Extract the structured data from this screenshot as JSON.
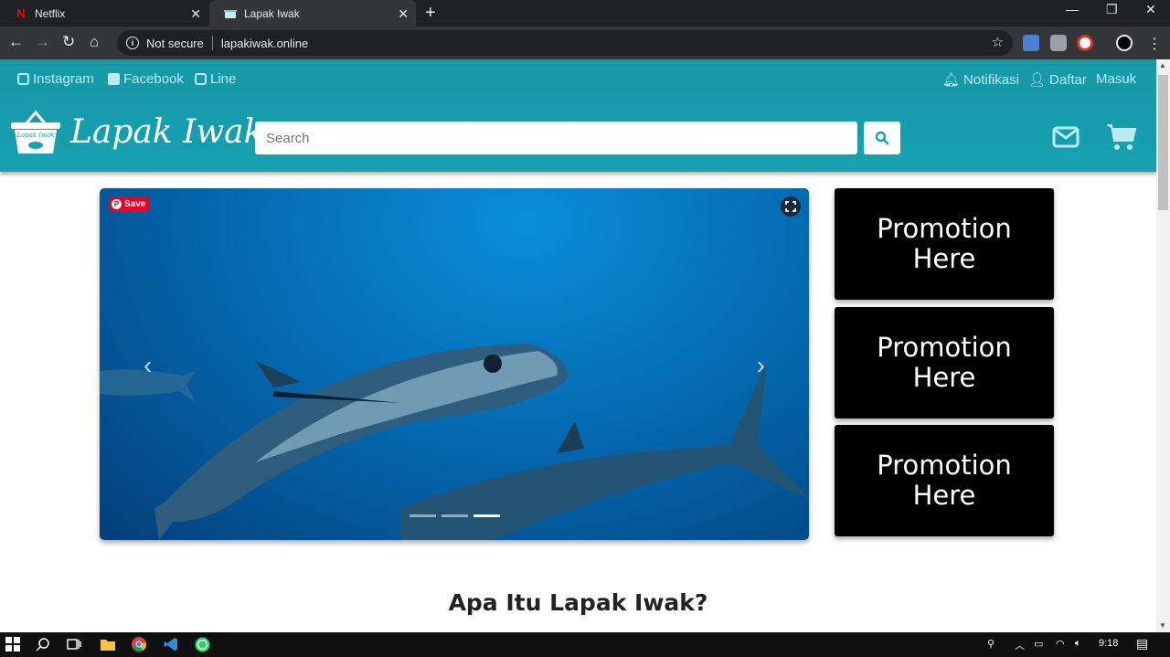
{
  "browser": {
    "tabs": [
      {
        "title": "Netflix",
        "active": false
      },
      {
        "title": "Lapak Iwak",
        "active": true
      }
    ],
    "security_label": "Not secure",
    "url": "lapakiwak.online"
  },
  "header": {
    "social_links": [
      "Instagram",
      "Facebook",
      "Line"
    ],
    "notification_label": "Notifikasi",
    "register_label": "Daftar",
    "login_label": "Masuk",
    "brand": "Lapak Iwak",
    "logo_text": "Lapak Iwak",
    "search_placeholder": "Search",
    "brand_color": "#17a2b8"
  },
  "carousel": {
    "save_label": "Save",
    "slide_count": 3,
    "active_slide": 3
  },
  "promos": [
    "Promotion Here",
    "Promotion Here",
    "Promotion Here"
  ],
  "section_title": "Apa Itu Lapak Iwak?",
  "taskbar": {
    "clock": "9:18",
    "apps": [
      "start-icon",
      "search-icon",
      "task-view-icon",
      "file-explorer-icon",
      "chrome-icon",
      "vscode-icon",
      "whatsapp-icon"
    ]
  }
}
